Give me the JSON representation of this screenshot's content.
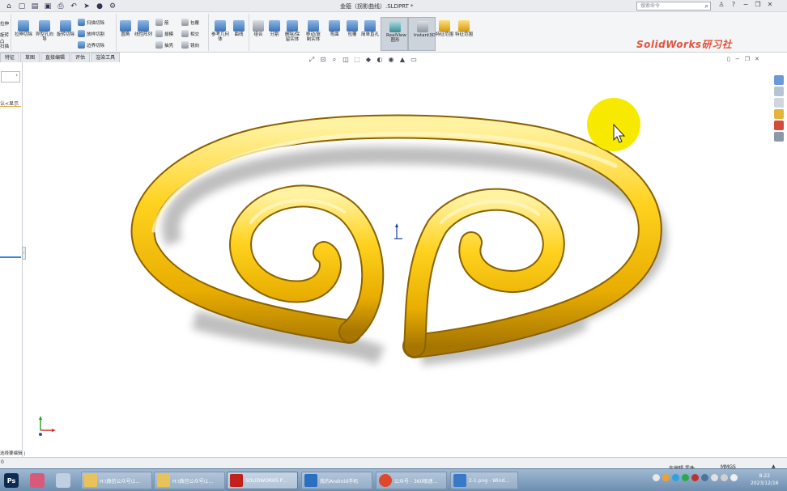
{
  "window": {
    "title": "金箍（拐影曲线）.SLDPRT *",
    "search_placeholder": "搜索命令",
    "watermark": "SolidWorks研习社"
  },
  "quick_access": [
    "home-icon",
    "new-icon",
    "open-icon",
    "save-icon",
    "print-icon",
    "undo-icon",
    "select-icon",
    "rebuild-icon",
    "options-icon"
  ],
  "ribbon": {
    "left_cut": [
      "拉伸",
      "旋转凸",
      "扫描"
    ],
    "features_big": [
      {
        "label": "拉伸切除"
      },
      {
        "label": "异型孔向导"
      },
      {
        "label": "旋转切除"
      }
    ],
    "features_small": [
      {
        "label": "扫描切除"
      },
      {
        "label": "放样切割"
      },
      {
        "label": "边界切除"
      }
    ],
    "group2_big": [
      {
        "label": "圆角"
      },
      {
        "label": "线性阵列"
      }
    ],
    "group2_small": [
      {
        "label": "筋"
      },
      {
        "label": "拔模"
      },
      {
        "label": "抽壳"
      },
      {
        "label": "包覆"
      },
      {
        "label": "相交"
      },
      {
        "label": "镜向"
      }
    ],
    "group3": [
      {
        "label": "参考几何体"
      },
      {
        "label": "曲线"
      }
    ],
    "group4": [
      {
        "label": "组合"
      },
      {
        "label": "分割"
      },
      {
        "label": "删除/保留实体"
      },
      {
        "label": "移动/复制实体"
      },
      {
        "label": "弯曲"
      },
      {
        "label": "包覆"
      },
      {
        "label": "简单直孔"
      },
      {
        "label": "RealView 图形"
      },
      {
        "label": "Instant3D"
      },
      {
        "label": "特征范围"
      },
      {
        "label": "特征范围"
      }
    ]
  },
  "tabs": [
    "特征",
    "草图",
    "直接编辑",
    "评估",
    "渲染工具"
  ],
  "left_panel": {
    "tree_label": "认<显示",
    "handle": "‹"
  },
  "status_bar": {
    "left": "0",
    "tree_status": "选择要编辑 |",
    "edit_state": "在编辑 零件",
    "units": "MMGS",
    "arrow": "▲"
  },
  "taskbar": {
    "start_label": "Ps",
    "buttons": [
      {
        "label": "H:\\微信公众号\\1..."
      },
      {
        "label": "H:\\微信公众号\\1..."
      },
      {
        "label": "SOLIDWORKS P..."
      },
      {
        "label": "我的Android手机"
      },
      {
        "label": "公众号 - 360极速..."
      },
      {
        "label": "2-1.png - Wind..."
      }
    ],
    "time": "8:22",
    "date": "2023/12/16"
  },
  "colors": {
    "gold_light": "#ffe066",
    "gold_mid": "#f2c00c",
    "gold_dark": "#b07f00",
    "shadow": "#9c9c9c",
    "highlight": "#f7ea00"
  }
}
